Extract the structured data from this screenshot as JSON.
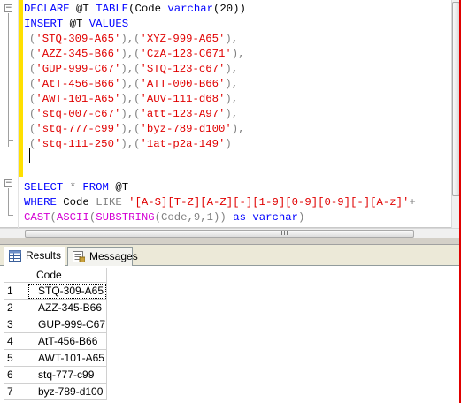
{
  "editor": {
    "lines": [
      [
        [
          "DECLARE ",
          "kw"
        ],
        [
          "@T ",
          ""
        ],
        [
          "TABLE",
          "kw"
        ],
        [
          "(Code ",
          ""
        ],
        [
          "varchar",
          "kw"
        ],
        [
          "(20))",
          ""
        ]
      ],
      [
        [
          "INSERT ",
          "kw"
        ],
        [
          "@T ",
          ""
        ],
        [
          "VALUES",
          "kw"
        ]
      ],
      [
        [
          "(",
          "op"
        ],
        [
          "'STQ-309-A65'",
          "str"
        ],
        [
          "),(",
          "op"
        ],
        [
          "'XYZ-999-A65'",
          "str"
        ],
        [
          "),",
          "op"
        ]
      ],
      [
        [
          "(",
          "op"
        ],
        [
          "'AZZ-345-B66'",
          "str"
        ],
        [
          "),(",
          "op"
        ],
        [
          "'CzA-123-C671'",
          "str"
        ],
        [
          "),",
          "op"
        ]
      ],
      [
        [
          "(",
          "op"
        ],
        [
          "'GUP-999-C67'",
          "str"
        ],
        [
          "),(",
          "op"
        ],
        [
          "'STQ-123-c67'",
          "str"
        ],
        [
          "),",
          "op"
        ]
      ],
      [
        [
          "(",
          "op"
        ],
        [
          "'AtT-456-B66'",
          "str"
        ],
        [
          "),(",
          "op"
        ],
        [
          "'ATT-000-B66'",
          "str"
        ],
        [
          "),",
          "op"
        ]
      ],
      [
        [
          "(",
          "op"
        ],
        [
          "'AWT-101-A65'",
          "str"
        ],
        [
          "),(",
          "op"
        ],
        [
          "'AUV-111-d68'",
          "str"
        ],
        [
          "),",
          "op"
        ]
      ],
      [
        [
          "(",
          "op"
        ],
        [
          "'stq-007-c67'",
          "str"
        ],
        [
          "),(",
          "op"
        ],
        [
          "'att-123-A97'",
          "str"
        ],
        [
          "),",
          "op"
        ]
      ],
      [
        [
          "(",
          "op"
        ],
        [
          "'stq-777-c99'",
          "str"
        ],
        [
          "),(",
          "op"
        ],
        [
          "'byz-789-d100'",
          "str"
        ],
        [
          "),",
          "op"
        ]
      ],
      [
        [
          "(",
          "op"
        ],
        [
          "'stq-111-250'",
          "str"
        ],
        [
          "),(",
          "op"
        ],
        [
          "'1at-p2a-149'",
          "str"
        ],
        [
          ")",
          "op"
        ]
      ],
      [],
      [],
      [
        [
          "SELECT ",
          "kw"
        ],
        [
          "* ",
          "op"
        ],
        [
          "FROM ",
          "kw"
        ],
        [
          "@T",
          ""
        ]
      ],
      [
        [
          "WHERE ",
          "kw"
        ],
        [
          "Code ",
          ""
        ],
        [
          "LIKE ",
          "op"
        ],
        [
          "'[A-S][T-Z][A-Z][-][1-9][0-9][0-9][-][A-z]'",
          "str"
        ],
        [
          "+",
          "op"
        ]
      ],
      [
        [
          "CAST",
          "fn"
        ],
        [
          "(",
          "op"
        ],
        [
          "ASCII",
          "fn"
        ],
        [
          "(",
          "op"
        ],
        [
          "SUBSTRING",
          "fn"
        ],
        [
          "(Code,9,1)) ",
          "op"
        ],
        [
          "as ",
          "kw"
        ],
        [
          "varchar",
          "kw"
        ],
        [
          ")",
          "op"
        ]
      ]
    ]
  },
  "tabs": {
    "results_label": "Results",
    "messages_label": "Messages"
  },
  "results": {
    "column_header": "Code",
    "rows": [
      {
        "num": "1",
        "code": "STQ-309-A65"
      },
      {
        "num": "2",
        "code": "AZZ-345-B66"
      },
      {
        "num": "3",
        "code": "GUP-999-C67"
      },
      {
        "num": "4",
        "code": "AtT-456-B66"
      },
      {
        "num": "5",
        "code": "AWT-101-A65"
      },
      {
        "num": "6",
        "code": "stq-777-c99"
      },
      {
        "num": "7",
        "code": "byz-789-d100"
      }
    ]
  }
}
